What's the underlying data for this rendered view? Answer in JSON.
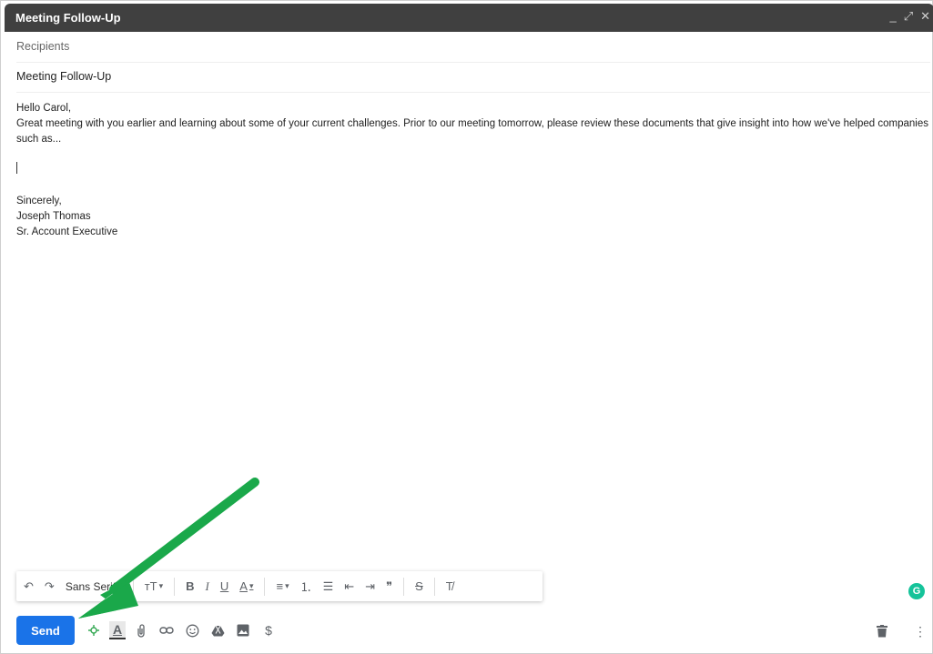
{
  "window": {
    "title": "Meeting Follow-Up",
    "controls": [
      "_",
      "⤢",
      "✕"
    ]
  },
  "compose": {
    "recipients_placeholder": "Recipients",
    "subject": "Meeting Follow-Up",
    "body": {
      "greeting": "Hello Carol,",
      "paragraph": "Great meeting with you earlier and learning about some of your current challenges. Prior to our meeting tomorrow, please review these documents that give insight into how we've helped companies such as...",
      "closing": "Sincerely,",
      "name": "Joseph Thomas",
      "title": "Sr. Account Executive"
    }
  },
  "format_toolbar": {
    "undo": "↶",
    "redo": "↷",
    "font": "Sans Serif",
    "text_size": "тT",
    "bold": "B",
    "italic": "I",
    "underline": "U",
    "text_color": "A",
    "align": "≡",
    "numbered_list": "⒈",
    "bulleted_list": "☰",
    "indent_less": "⇤",
    "indent_more": "⇥",
    "quote": "❞",
    "strikethrough": "S",
    "remove_formatting": "T̸"
  },
  "bottom_bar": {
    "send_label": "Send",
    "icons": [
      "spark-icon",
      "formatting-icon",
      "attach-icon",
      "link-icon",
      "emoji-icon",
      "drive-icon",
      "photo-icon",
      "dollar-icon"
    ],
    "dollar": "$",
    "delete": "🗑",
    "more": "⋮"
  },
  "grammarly": {
    "badge": "G",
    "color": "#15c39a"
  },
  "annotation": {
    "arrow_color": "#1aa84a"
  },
  "colors": {
    "titlebar": "#404040",
    "send_button": "#1a73e8"
  }
}
